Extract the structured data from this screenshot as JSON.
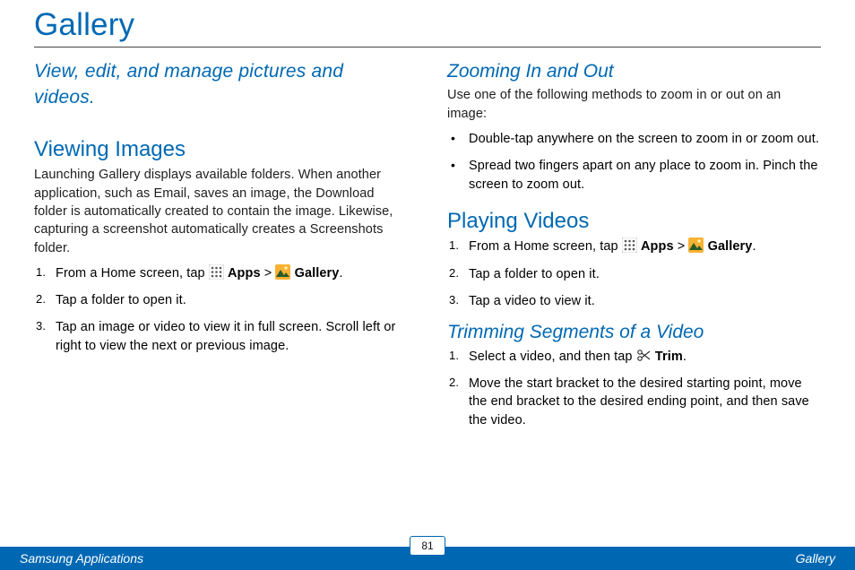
{
  "title": "Gallery",
  "footer": {
    "left": "Samsung Applications",
    "page": "81",
    "right": "Gallery"
  },
  "left": {
    "subtitle": "View, edit, and manage pictures and videos.",
    "viewing": {
      "heading": "Viewing Images",
      "body": "Launching Gallery displays available folders. When another application, such as Email, saves an image, the Download folder is automatically created to contain the image. Likewise, capturing a screenshot automatically creates a Screenshots folder.",
      "step1_pre": "From a Home screen, tap ",
      "step1_apps": "Apps",
      "step1_gt": " > ",
      "step1_gallery": "Gallery",
      "step1_post": ".",
      "step2": "Tap a folder to open it.",
      "step3": "Tap an image or video to view it in full screen. Scroll left or right to view the next or previous image."
    }
  },
  "right": {
    "zoom": {
      "heading": "Zooming In and Out",
      "body": "Use one of the following methods to zoom in or out on an image:",
      "b1": "Double-tap anywhere on the screen to zoom in or zoom out.",
      "b2": "Spread two fingers apart on any place to zoom in. Pinch the screen to zoom out."
    },
    "playing": {
      "heading": "Playing Videos",
      "step1_pre": "From a Home screen, tap ",
      "step1_apps": "Apps",
      "step1_gt": " > ",
      "step1_gallery": "Gallery",
      "step1_post": ".",
      "step2": "Tap a folder to open it.",
      "step3": "Tap a video to view it."
    },
    "trim": {
      "heading": "Trimming Segments of a Video",
      "step1_pre": "Select a video, and then tap ",
      "step1_trim": "Trim",
      "step1_post": ".",
      "step2": "Move the start bracket to the desired starting point, move the end bracket to the desired ending point, and then save the video."
    }
  }
}
